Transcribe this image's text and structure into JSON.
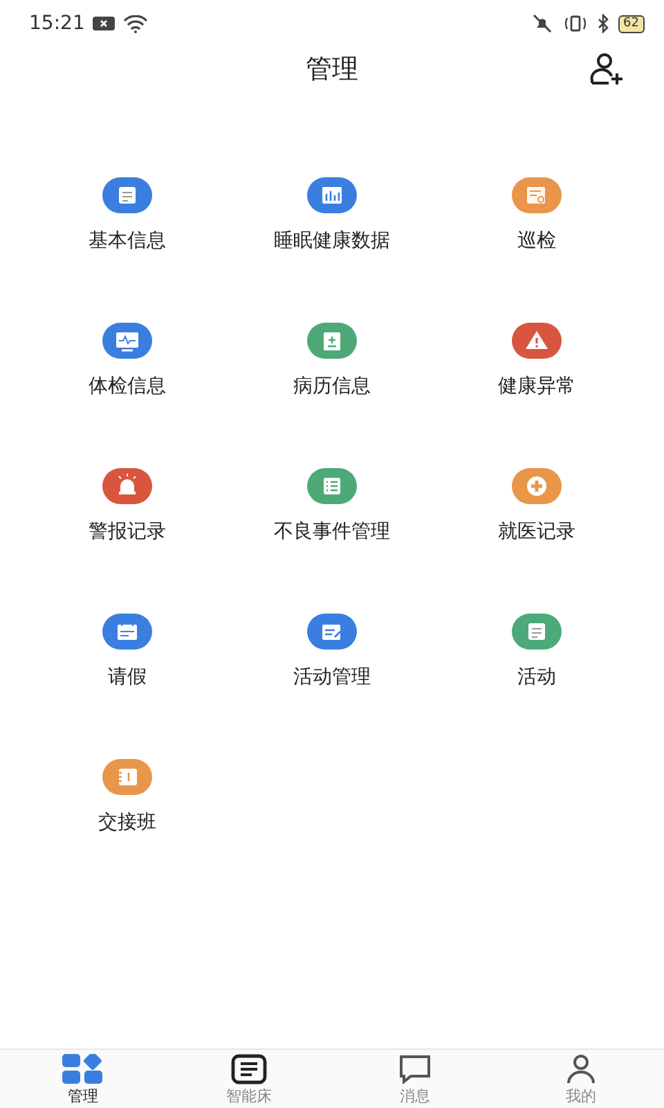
{
  "status_bar": {
    "time": "15:21",
    "battery": "62"
  },
  "header": {
    "title": "管理"
  },
  "menu": [
    {
      "label": "基本信息",
      "color": "#3a7fe0"
    },
    {
      "label": "睡眠健康数据",
      "color": "#3a7fe0"
    },
    {
      "label": "巡检",
      "color": "#e9954a"
    },
    {
      "label": "体检信息",
      "color": "#3a7fe0"
    },
    {
      "label": "病历信息",
      "color": "#4daa78"
    },
    {
      "label": "健康异常",
      "color": "#d9553f"
    },
    {
      "label": "警报记录",
      "color": "#d9553f"
    },
    {
      "label": "不良事件管理",
      "color": "#4daa78"
    },
    {
      "label": "就医记录",
      "color": "#e9954a"
    },
    {
      "label": "请假",
      "color": "#3a7fe0"
    },
    {
      "label": "活动管理",
      "color": "#3a7fe0"
    },
    {
      "label": "活动",
      "color": "#4daa78"
    },
    {
      "label": "交接班",
      "color": "#e9954a"
    }
  ],
  "tabs": [
    {
      "label": "管理",
      "selected": true
    },
    {
      "label": "智能床",
      "selected": false
    },
    {
      "label": "消息",
      "selected": false
    },
    {
      "label": "我的",
      "selected": false
    }
  ]
}
